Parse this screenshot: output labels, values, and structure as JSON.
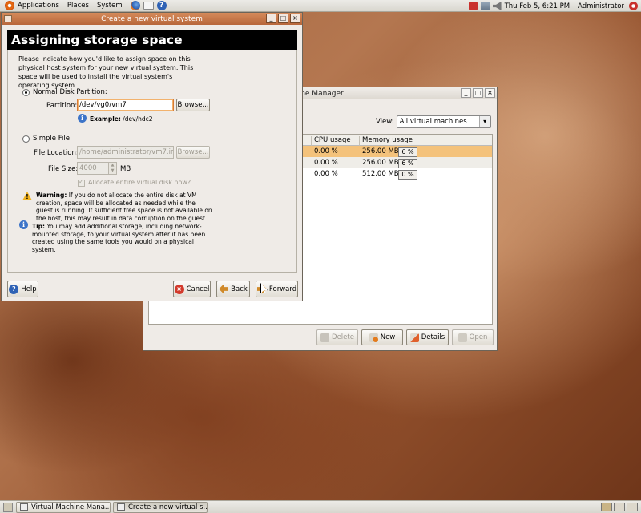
{
  "top_panel": {
    "menus": [
      "Applications",
      "Places",
      "System"
    ],
    "clock": "Thu Feb  5,  6:21 PM",
    "user": "Administrator"
  },
  "vmm_window": {
    "title": "Virtual Machine Manager",
    "title_visible": "hine Manager",
    "view_label": "View:",
    "view_value": "All virtual machines",
    "columns": {
      "cpu": "CPU usage",
      "memory": "Memory usage"
    },
    "rows": [
      {
        "cpu": "0.00 %",
        "memory": "256.00 MB",
        "pct": "6 %",
        "selected": true
      },
      {
        "cpu": "0.00 %",
        "memory": "256.00 MB",
        "pct": "6 %",
        "selected": false
      },
      {
        "cpu": "0.00 %",
        "memory": "512.00 MB",
        "pct": "0 %",
        "selected": false
      }
    ],
    "buttons": {
      "delete": "Delete",
      "new": "New",
      "details": "Details",
      "open": "Open"
    }
  },
  "wizard": {
    "title": "Create a new virtual system",
    "heading": "Assigning storage space",
    "intro": "Please indicate how you'd like to assign space on this physical host system for your new virtual system. This space will be used to install the virtual system's operating system.",
    "normal_partition_label": "Normal Disk Partition:",
    "partition_label": "Partition:",
    "partition_value": "/dev/vg0/vm7",
    "browse_label": "Browse...",
    "example_label": "Example:",
    "example_value": "/dev/hdc2",
    "simple_file_label": "Simple File:",
    "file_location_label": "File Location:",
    "file_location_value": "/home/administrator/vm7.img",
    "browse2_label": "Browse...",
    "file_size_label": "File Size:",
    "file_size_value": "4000",
    "file_size_unit": "MB",
    "allocate_label": "Allocate entire virtual disk now?",
    "warning_title": "Warning:",
    "warning_text": "If you do not allocate the entire disk at VM creation, space will be allocated as needed while the guest is running. If sufficient free space is not available on the host, this may result in data corruption on the guest.",
    "tip_title": "Tip:",
    "tip_text": "You may add additional storage, including network-mounted storage, to your virtual system after it has been created using the same tools you would on a physical system.",
    "buttons": {
      "help": "Help",
      "cancel": "Cancel",
      "back": "Back",
      "forward": "Forward"
    }
  },
  "taskbar": {
    "items": [
      "Virtual Machine Mana...",
      "Create a new virtual s..."
    ]
  }
}
